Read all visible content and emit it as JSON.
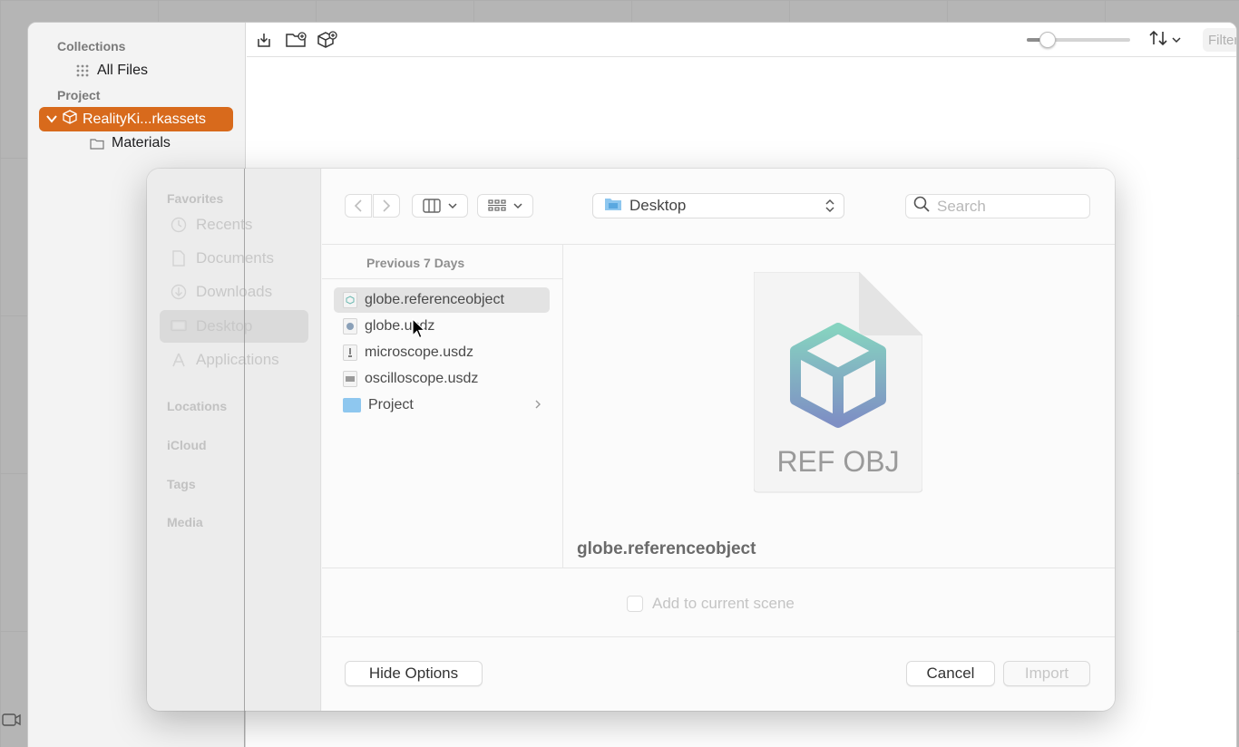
{
  "colors": {
    "accent": "#d86a1c",
    "folder": "#8ec7ef",
    "selection": "#e3e3e3"
  },
  "window": {
    "sidebar": {
      "collections_label": "Collections",
      "all_files_label": "All Files",
      "project_label": "Project",
      "project_item_label": "RealityKi...rkassets",
      "materials_label": "Materials"
    },
    "toolbar": {
      "icons": [
        "import-icon",
        "new-folder-icon",
        "add-asset-icon"
      ],
      "zoom_level": 0.2,
      "filter_placeholder": "Filter",
      "filter_value": ""
    }
  },
  "dialog": {
    "sidebar": {
      "favorites_label": "Favorites",
      "favorites": [
        {
          "label": "Recents",
          "icon": "clock-icon"
        },
        {
          "label": "Documents",
          "icon": "document-icon"
        },
        {
          "label": "Downloads",
          "icon": "download-icon"
        },
        {
          "label": "Desktop",
          "icon": "desktop-icon"
        },
        {
          "label": "Applications",
          "icon": "applications-icon"
        }
      ],
      "locations_label": "Locations",
      "icloud_label": "iCloud",
      "tags_label": "Tags",
      "media_label": "Media"
    },
    "location": "Desktop",
    "search_placeholder": "Search",
    "search_value": "",
    "file_list": {
      "header": "Previous 7 Days",
      "items": [
        {
          "name": "globe.referenceobject",
          "icon": "referenceobject-file-icon"
        },
        {
          "name": "globe.usdz",
          "icon": "usdz-file-icon"
        },
        {
          "name": "microscope.usdz",
          "icon": "usdz-file-icon"
        },
        {
          "name": "oscilloscope.usdz",
          "icon": "usdz-file-icon"
        },
        {
          "name": "Project",
          "icon": "folder-icon"
        }
      ]
    },
    "preview": {
      "doc_label": "REF OBJ",
      "file_name": "globe.referenceobject"
    },
    "options": {
      "add_to_scene_label": "Add to current scene",
      "add_to_scene_checked": false
    },
    "buttons": {
      "hide_options": "Hide Options",
      "cancel": "Cancel",
      "import": "Import"
    }
  }
}
